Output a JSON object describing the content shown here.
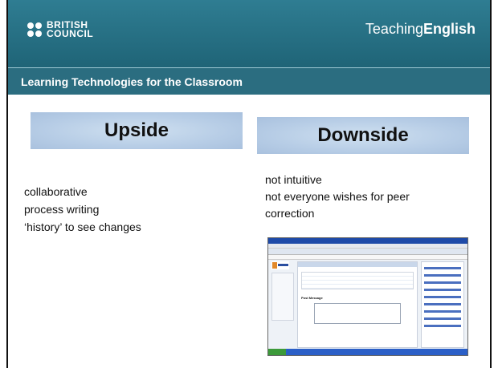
{
  "header": {
    "logo_line1": "BRITISH",
    "logo_line2": "COUNCIL",
    "teaching_prefix": "Teaching",
    "teaching_bold": "English"
  },
  "subheader": {
    "title": "Learning Technologies for the Classroom"
  },
  "upside": {
    "title": "Upside",
    "items": [
      "collaborative",
      "process writing",
      "‘history’ to see changes"
    ]
  },
  "downside": {
    "title": "Downside",
    "items": [
      "not intuitive",
      "not everyone wishes for peer",
      "correction"
    ]
  },
  "screenshot": {
    "post_message_label": "Post Message"
  },
  "colors": {
    "header_teal": "#2f7d92",
    "subheader_teal": "#2b6d80",
    "box_blue": "#b7cde6"
  }
}
